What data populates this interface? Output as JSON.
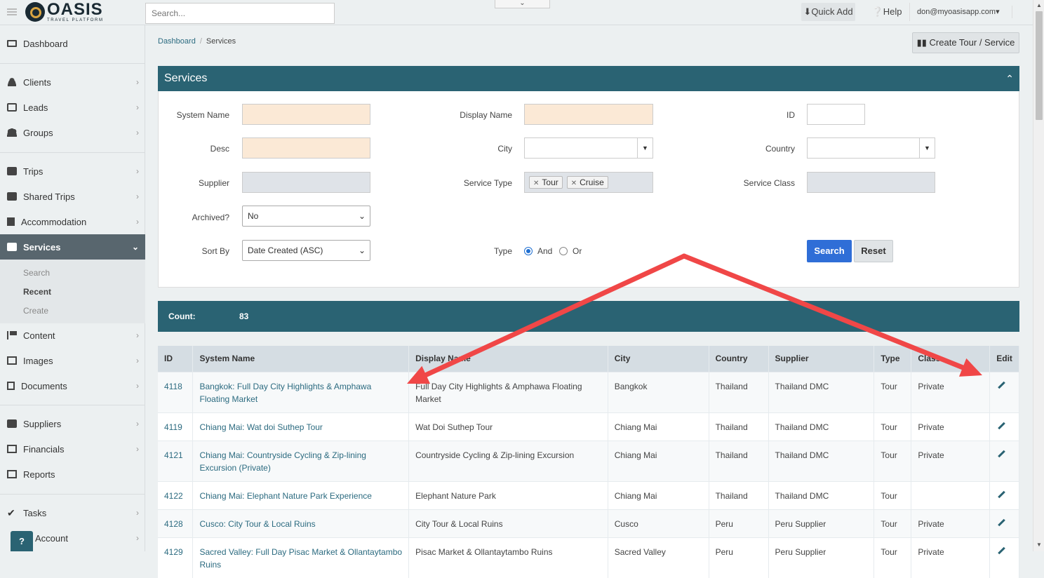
{
  "app": {
    "logo_name": "OASIS",
    "logo_tagline": "TRAVEL PLATFORM"
  },
  "topbar": {
    "search_placeholder": "Search...",
    "quick_add": "Quick Add",
    "help": "Help",
    "user": "don@myoasisapp.com"
  },
  "sidebar": {
    "items": [
      {
        "label": "Dashboard",
        "icon": "monitor-icon"
      },
      {
        "label": "Clients",
        "icon": "user-icon"
      },
      {
        "label": "Leads",
        "icon": "inbox-icon"
      },
      {
        "label": "Groups",
        "icon": "group-icon"
      },
      {
        "label": "Trips",
        "icon": "briefcase-icon"
      },
      {
        "label": "Shared Trips",
        "icon": "briefcase-icon"
      },
      {
        "label": "Accommodation",
        "icon": "building-icon"
      },
      {
        "label": "Services",
        "icon": "binoculars-icon"
      },
      {
        "label": "Content",
        "icon": "flag-icon"
      },
      {
        "label": "Images",
        "icon": "image-icon"
      },
      {
        "label": "Documents",
        "icon": "document-icon"
      },
      {
        "label": "Suppliers",
        "icon": "briefcase-icon"
      },
      {
        "label": "Financials",
        "icon": "money-icon"
      },
      {
        "label": "Reports",
        "icon": "list-icon"
      },
      {
        "label": "Tasks",
        "icon": "check-icon"
      },
      {
        "label": "Account",
        "icon": "account-icon"
      }
    ],
    "sub_items": [
      "Search",
      "Recent",
      "Create"
    ],
    "help_bubble": "?"
  },
  "breadcrumb": {
    "home": "Dashboard",
    "separator": "/",
    "current": "Services"
  },
  "create_button": "Create Tour / Service",
  "panel": {
    "title": "Services",
    "fields": {
      "system_name": "System Name",
      "display_name": "Display Name",
      "id": "ID",
      "desc": "Desc",
      "city": "City",
      "country": "Country",
      "supplier": "Supplier",
      "service_type": "Service Type",
      "service_class": "Service Class",
      "archived": "Archived?",
      "sort_by": "Sort By",
      "type": "Type"
    },
    "service_type_tags": [
      "Tour",
      "Cruise"
    ],
    "archived_value": "No",
    "sort_by_value": "Date Created (ASC)",
    "type_options": [
      "And",
      "Or"
    ],
    "type_selected": "And",
    "search_button": "Search",
    "reset_button": "Reset"
  },
  "count": {
    "label": "Count:",
    "value": "83"
  },
  "table": {
    "headers": [
      "ID",
      "System Name",
      "Display Name",
      "City",
      "Country",
      "Supplier",
      "Type",
      "Class",
      "Edit"
    ],
    "rows": [
      {
        "id": "4118",
        "system_name": "Bangkok: Full Day City Highlights & Amphawa Floating Market",
        "display_name": "Full Day City Highlights & Amphawa Floating Market",
        "city": "Bangkok",
        "country": "Thailand",
        "supplier": "Thailand DMC",
        "type": "Tour",
        "class": "Private"
      },
      {
        "id": "4119",
        "system_name": "Chiang Mai: Wat doi Suthep Tour",
        "display_name": "Wat Doi Suthep Tour",
        "city": "Chiang Mai",
        "country": "Thailand",
        "supplier": "Thailand DMC",
        "type": "Tour",
        "class": "Private"
      },
      {
        "id": "4121",
        "system_name": "Chiang Mai: Countryside Cycling & Zip-lining Excursion (Private)",
        "display_name": "Countryside Cycling & Zip-lining Excursion",
        "city": "Chiang Mai",
        "country": "Thailand",
        "supplier": "Thailand DMC",
        "type": "Tour",
        "class": "Private"
      },
      {
        "id": "4122",
        "system_name": "Chiang Mai: Elephant Nature Park Experience",
        "display_name": "Elephant Nature Park",
        "city": "Chiang Mai",
        "country": "Thailand",
        "supplier": "Thailand DMC",
        "type": "Tour",
        "class": ""
      },
      {
        "id": "4128",
        "system_name": "Cusco: City Tour & Local Ruins",
        "display_name": "City Tour & Local Ruins",
        "city": "Cusco",
        "country": "Peru",
        "supplier": "Peru Supplier",
        "type": "Tour",
        "class": "Private"
      },
      {
        "id": "4129",
        "system_name": "Sacred Valley: Full Day Pisac Market & Ollantaytambo Ruins",
        "display_name": "Pisac Market & Ollantaytambo Ruins",
        "city": "Sacred Valley",
        "country": "Peru",
        "supplier": "Peru Supplier",
        "type": "Tour",
        "class": "Private"
      }
    ]
  },
  "colors": {
    "accent": "#2a6373",
    "primary_button": "#2f6ed7",
    "annotation_arrow": "#f04747"
  }
}
